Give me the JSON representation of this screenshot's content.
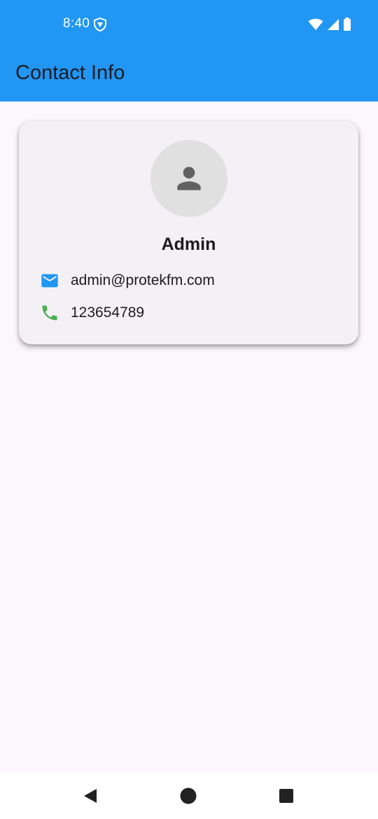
{
  "status_bar": {
    "time": "8:40",
    "icons": [
      "vpn-shield-icon",
      "wifi-icon",
      "cellular-signal-icon",
      "battery-icon"
    ],
    "background": "#2196f3"
  },
  "app_bar": {
    "title": "Contact Info",
    "background": "#2196f3"
  },
  "contact": {
    "avatar_icon": "person-icon",
    "name": "Admin",
    "email": "admin@protekfm.com",
    "email_icon": "email-icon",
    "email_icon_color": "#2196f3",
    "phone": "123654789",
    "phone_icon": "phone-icon",
    "phone_icon_color": "#4caf50"
  },
  "nav_bar": {
    "buttons": [
      "back-icon",
      "home-icon",
      "recents-icon"
    ]
  }
}
